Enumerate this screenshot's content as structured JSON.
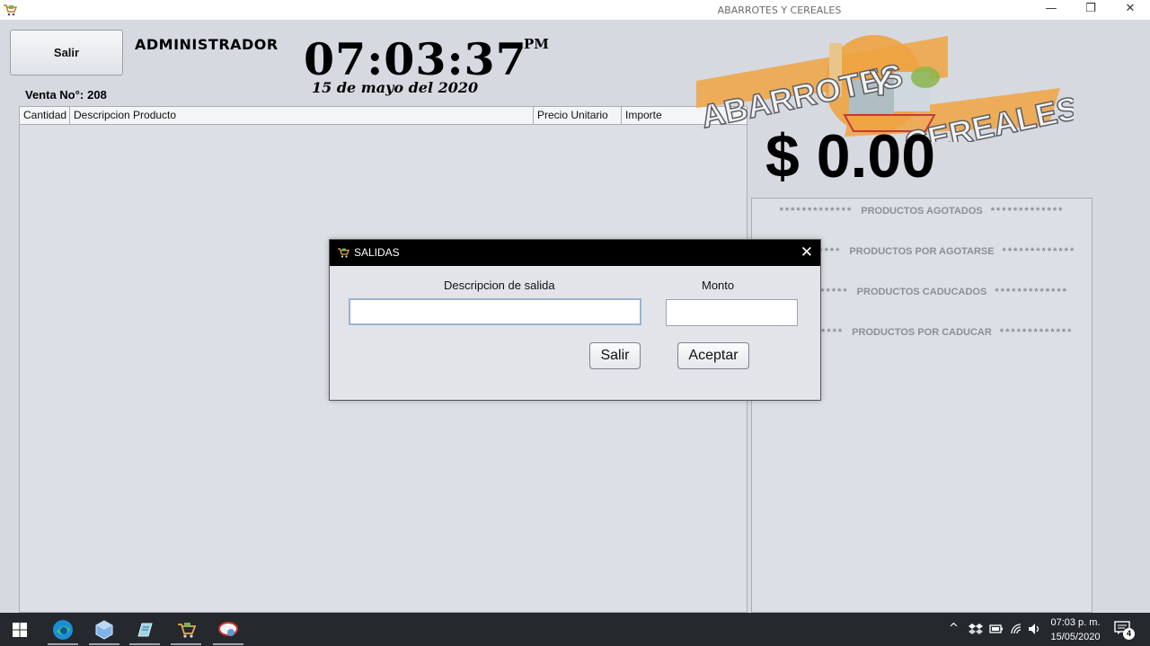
{
  "window": {
    "title": "ABARROTES Y CEREALES",
    "controls": {
      "minimize": "—",
      "restore": "❐",
      "close": "✕"
    }
  },
  "header": {
    "exit_label": "Salir",
    "role": "ADMINISTRADOR",
    "time": "07:03:37",
    "ampm": "PM",
    "date": "15 de mayo del 2020"
  },
  "sale": {
    "label": "Venta No°:",
    "number": "208"
  },
  "table": {
    "columns": [
      "Cantidad",
      "Descripcion Producto",
      "Precio Unitario",
      "Importe"
    ],
    "rows": []
  },
  "logo": {
    "line1": "ABARROTES",
    "line2": "Y",
    "line3": "CEREALES"
  },
  "total": "$ 0.00",
  "panel": {
    "stars": "*************",
    "items": [
      "PRODUCTOS AGOTADOS",
      "PRODUCTOS POR AGOTARSE",
      "PRODUCTOS CADUCADOS",
      "PRODUCTOS POR CADUCAR"
    ]
  },
  "dialog": {
    "title": "SALIDAS",
    "close": "✕",
    "desc_label": "Descripcion de salida",
    "amount_label": "Monto",
    "desc_value": "",
    "amount_value": "",
    "cancel_label": "Salir",
    "ok_label": "Aceptar"
  },
  "taskbar": {
    "apps": [
      "start",
      "edge",
      "virtualbox",
      "notes",
      "abarrotes-app",
      "remote-app"
    ],
    "tray": {
      "chevron": "^",
      "notification_count": "4"
    },
    "time": "07:03 p. m.",
    "date": "15/05/2020"
  },
  "colors": {
    "background": "#d6d9e0",
    "dialog_title": "#000000",
    "taskbar": "#25282d",
    "logo_orange": "#f0a341",
    "logo_text": "#5a5e66"
  }
}
